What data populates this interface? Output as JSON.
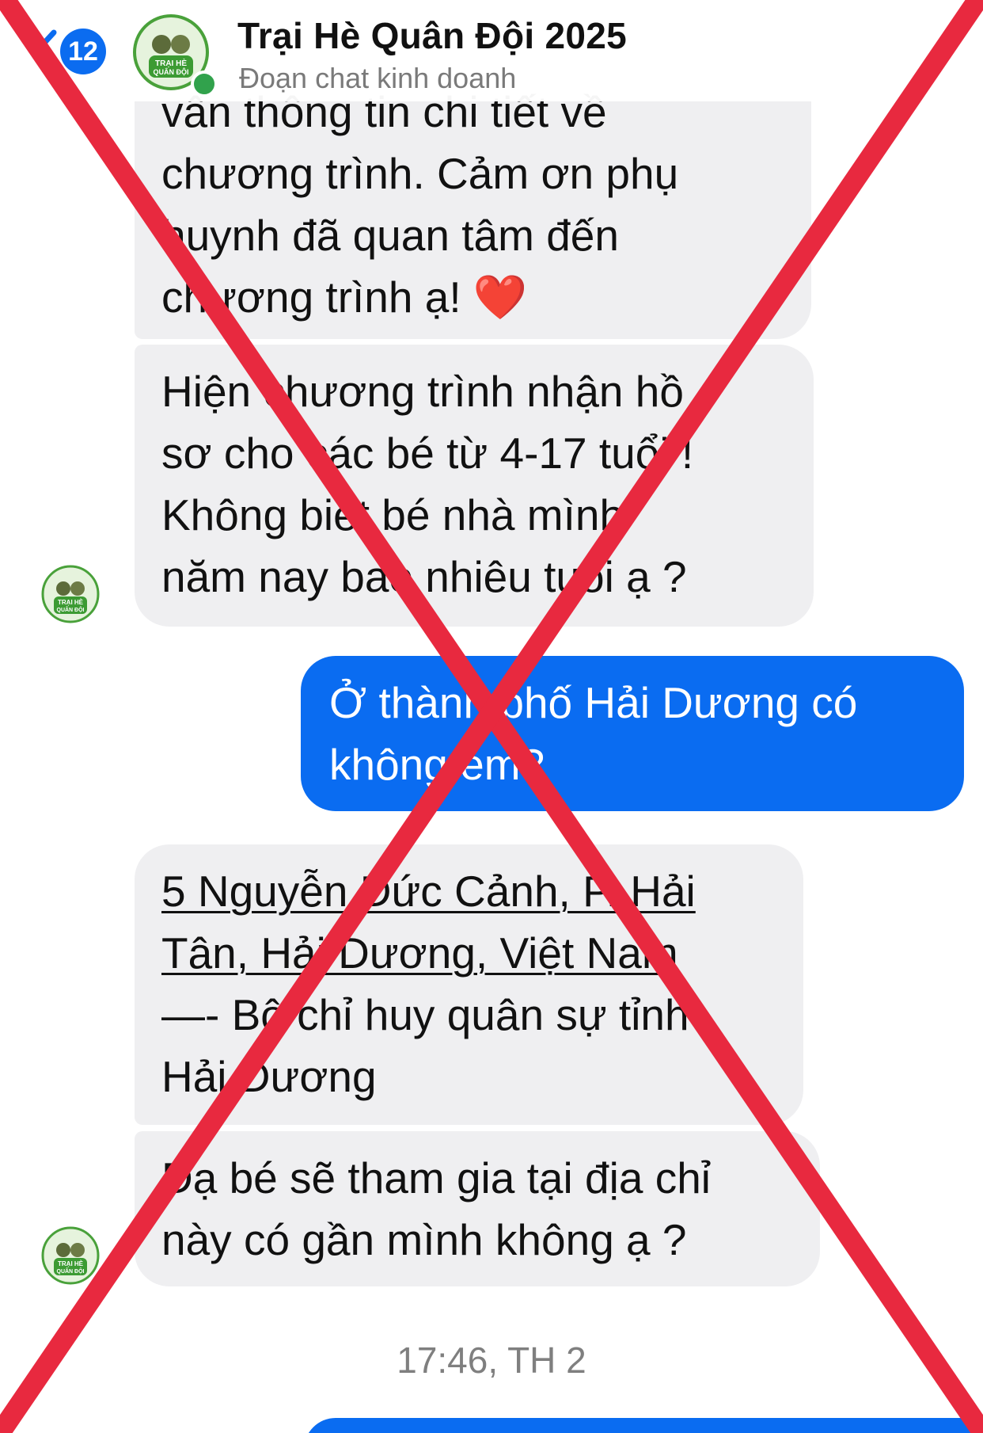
{
  "header": {
    "unread_count": "12",
    "title": "Trại Hè Quân Đội 2025",
    "subtitle": "Đoạn chat kinh doanh"
  },
  "messages": [
    {
      "direction": "incoming",
      "lines": [
        "vấn thông tin chi tiết về",
        "chương trình. Cảm ơn phụ",
        "huynh đã quan tâm đến",
        "chương trình ạ! ❤️"
      ]
    },
    {
      "direction": "incoming",
      "lines": [
        "Hiện chương trình nhận hồ",
        "sơ cho các bé từ 4-17 tuổi !",
        "Không biết bé nhà mình",
        "năm nay bao nhiêu tuổi ạ ?"
      ]
    },
    {
      "direction": "outgoing",
      "lines": [
        "Ở thành phố Hải Dương có",
        "không em?"
      ]
    },
    {
      "direction": "incoming",
      "lines": [
        "5 Nguyễn Đức Cảnh, P. Hải",
        "Tân, Hải Dương, Việt Nam",
        "—- Bộ chỉ huy quân sự tỉnh",
        "Hải Dương"
      ]
    },
    {
      "direction": "incoming",
      "lines": [
        "Dạ bé sẽ tham gia tại địa chỉ",
        "này có gần mình không ạ ?"
      ]
    }
  ],
  "timestamp": "17:46, TH 2",
  "avatar_text": [
    "TRẠI HÈ",
    "QUÂN ĐỘI"
  ],
  "colors": {
    "accent_blue": "#0a6cf1",
    "incoming_bubble": "#efeff1",
    "overlay_x": "#e8293f",
    "online_green": "#31a24c"
  },
  "icons": {
    "back": "chevron-left-icon",
    "overlay": "red-x-mark"
  }
}
